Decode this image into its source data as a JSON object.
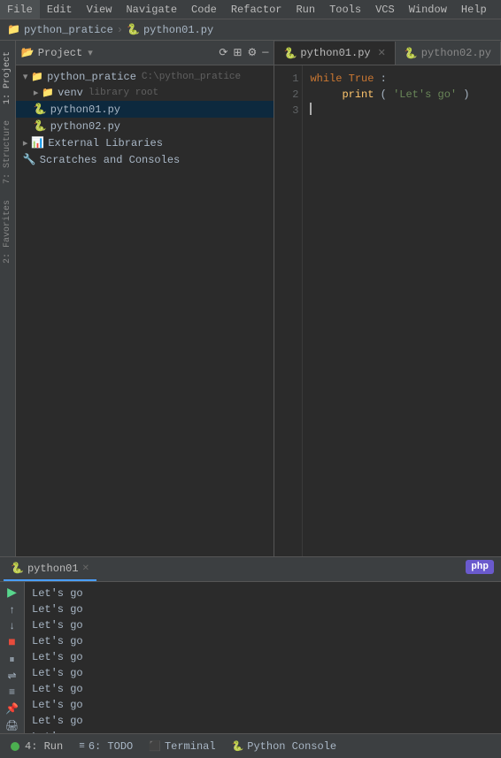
{
  "menubar": {
    "items": [
      "File",
      "Edit",
      "View",
      "Navigate",
      "Code",
      "Refactor",
      "Run",
      "Tools",
      "VCS",
      "Window",
      "Help"
    ]
  },
  "breadcrumb": {
    "project": "python_pratice",
    "file": "python01.py"
  },
  "project_panel": {
    "title": "Project",
    "root": "python_pratice",
    "root_path": "C:\\python_pratice",
    "venv": "venv",
    "venv_label": "library root",
    "files": [
      "python01.py",
      "python02.py"
    ],
    "external_libs": "External Libraries",
    "scratches": "Scratches and Consoles"
  },
  "tabs": [
    {
      "label": "python01.py",
      "active": true
    },
    {
      "label": "python02.py",
      "active": false
    }
  ],
  "editor": {
    "lines": [
      "1",
      "2",
      "3"
    ],
    "code": [
      {
        "text": "while True:",
        "type": "while_true"
      },
      {
        "text": "    print('Let’s go')",
        "type": "print"
      },
      {
        "text": "",
        "type": "cursor"
      }
    ]
  },
  "run_panel": {
    "tab_label": "python01",
    "output_lines": [
      "Let’s go",
      "Let’s go",
      "Let’s go",
      "Let’s go",
      "Let’s go",
      "Let’s go",
      "Let’s go",
      "Let’s go",
      "Let’s go",
      "Let’s go"
    ]
  },
  "bottom_bar": {
    "run_label": "4: Run",
    "todo_label": "6: TODO",
    "terminal_label": "Terminal",
    "python_console_label": "Python Console"
  },
  "left_sidebar": {
    "labels": [
      "1: Project",
      "2: Favorites",
      "7: Structure"
    ]
  },
  "php_badge": "php"
}
